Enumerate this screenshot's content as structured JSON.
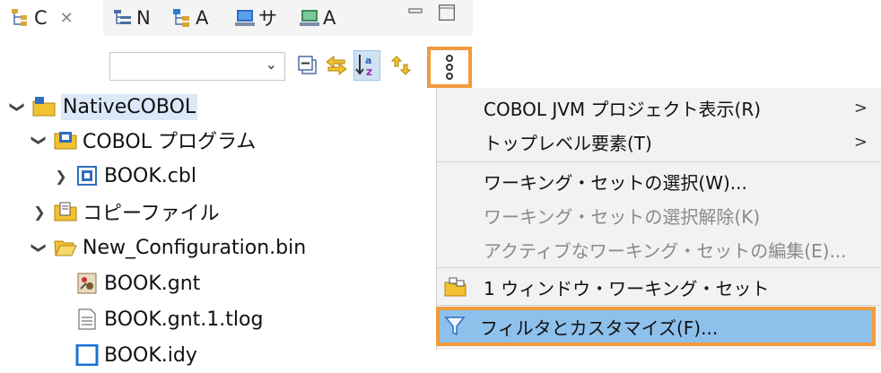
{
  "tabs": [
    {
      "label": "C",
      "icon": "package-explorer-icon",
      "active": true
    },
    {
      "label": "N",
      "icon": "navigator-icon"
    },
    {
      "label": "A",
      "icon": "application-explorer-icon"
    },
    {
      "label": "サ",
      "icon": "server-icon"
    },
    {
      "label": "A",
      "icon": "monitor-icon"
    }
  ],
  "tab_close": "✕",
  "toolbar": {
    "combo_value": "",
    "combo_arrow": "⌄",
    "icons": [
      "collapse-all-icon",
      "link-with-editor-icon",
      "sort-alphabetically-icon",
      "hide-icon",
      "view-menu-icon"
    ]
  },
  "tree": [
    {
      "label": "NativeCOBOL",
      "icon": "project-icon",
      "expanded": true,
      "level": 0,
      "selected": true
    },
    {
      "label": "COBOL プログラム",
      "icon": "folder-program-icon",
      "expanded": true,
      "level": 1
    },
    {
      "label": "BOOK.cbl",
      "icon": "cobol-file-icon",
      "expanded": false,
      "level": 2
    },
    {
      "label": "コピーファイル",
      "icon": "folder-copy-icon",
      "expanded": false,
      "level": 1
    },
    {
      "label": "New_Configuration.bin",
      "icon": "folder-open-icon",
      "expanded": true,
      "level": 1
    },
    {
      "label": "BOOK.gnt",
      "icon": "gnt-file-icon",
      "level": 2
    },
    {
      "label": "BOOK.gnt.1.tlog",
      "icon": "text-file-icon",
      "level": 2
    },
    {
      "label": "BOOK.idy",
      "icon": "idy-file-icon",
      "level": 2
    }
  ],
  "menu": [
    {
      "label": "COBOL JVM プロジェクト表示(R)",
      "submenu": true,
      "enabled": true
    },
    {
      "label": "トップレベル要素(T)",
      "submenu": true,
      "enabled": true
    },
    {
      "label": "ワーキング・セットの選択(W)...",
      "enabled": true
    },
    {
      "label": "ワーキング・セットの選択解除(K)",
      "enabled": false
    },
    {
      "label": "アクティブなワーキング・セットの編集(E)...",
      "enabled": false
    },
    {
      "label": "1 ウィンドウ・ワーキング・セット",
      "enabled": true,
      "icon": "working-set-icon"
    },
    {
      "label": "フィルタとカスタマイズ(F)...",
      "enabled": true,
      "icon": "filter-icon",
      "highlighted": true
    }
  ],
  "submenu_arrow": ">",
  "colors": {
    "highlight": "#8ec0ec",
    "callout": "#f29a3e",
    "selection": "#dbe8f8"
  }
}
